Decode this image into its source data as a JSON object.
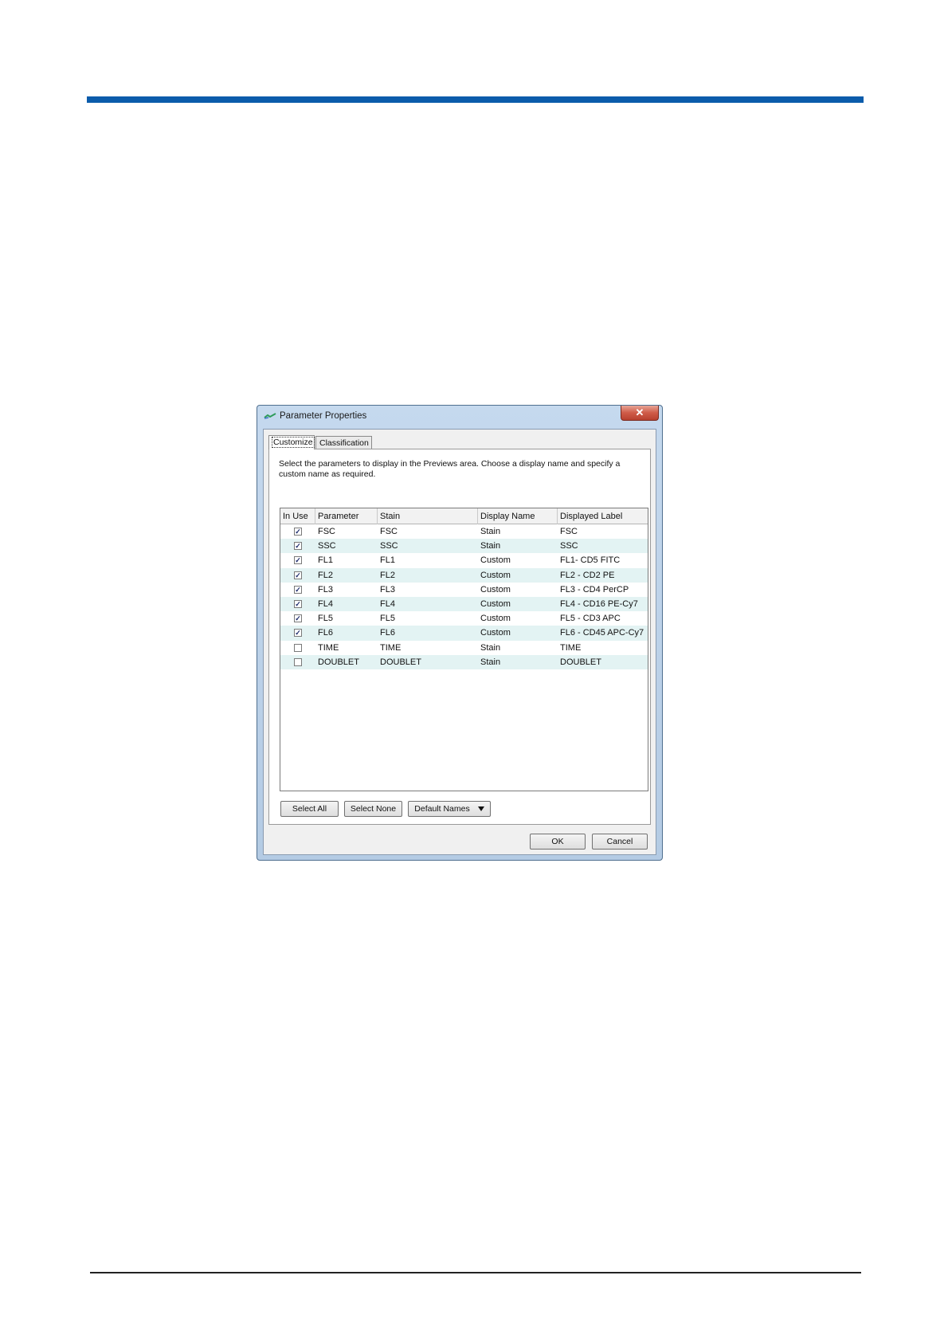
{
  "colors": {
    "accent_rule": "#0b5cab",
    "row_alt": "#e3f3f3"
  },
  "dialog": {
    "title": "Parameter Properties",
    "close_glyph": "✕",
    "tabs": [
      {
        "label": "Customize",
        "active": true
      },
      {
        "label": "Classification",
        "active": false
      }
    ],
    "instructions": "Select the parameters to display in the Previews area. Choose a display name and specify a custom name as required.",
    "columns": [
      "In Use",
      "Parameter",
      "Stain",
      "Display Name",
      "Displayed Label"
    ],
    "rows": [
      {
        "in_use": "☑",
        "parameter": "FSC",
        "stain": "FSC",
        "display_name": "Stain",
        "displayed_label": "FSC"
      },
      {
        "in_use": "☑",
        "parameter": "SSC",
        "stain": "SSC",
        "display_name": "Stain",
        "displayed_label": "SSC"
      },
      {
        "in_use": "☑",
        "parameter": "FL1",
        "stain": "FL1",
        "display_name": "Custom",
        "displayed_label": "FL1- CD5 FITC"
      },
      {
        "in_use": "☑",
        "parameter": "FL2",
        "stain": "FL2",
        "display_name": "Custom",
        "displayed_label": "FL2 - CD2 PE"
      },
      {
        "in_use": "☑",
        "parameter": "FL3",
        "stain": "FL3",
        "display_name": "Custom",
        "displayed_label": "FL3 - CD4 PerCP"
      },
      {
        "in_use": "☑",
        "parameter": "FL4",
        "stain": "FL4",
        "display_name": "Custom",
        "displayed_label": "FL4 - CD16 PE-Cy7"
      },
      {
        "in_use": "☑",
        "parameter": "FL5",
        "stain": "FL5",
        "display_name": "Custom",
        "displayed_label": "FL5 - CD3 APC"
      },
      {
        "in_use": "☑",
        "parameter": "FL6",
        "stain": "FL6",
        "display_name": "Custom",
        "displayed_label": "FL6 - CD45 APC-Cy7"
      },
      {
        "in_use": "☐",
        "parameter": "TIME",
        "stain": "TIME",
        "display_name": "Stain",
        "displayed_label": "TIME"
      },
      {
        "in_use": "☐",
        "parameter": "DOUBLET",
        "stain": "DOUBLET",
        "display_name": "Stain",
        "displayed_label": "DOUBLET"
      }
    ],
    "buttons": {
      "select_all": "Select All",
      "select_none": "Select None",
      "default_names": "Default Names",
      "ok": "OK",
      "cancel": "Cancel"
    }
  }
}
